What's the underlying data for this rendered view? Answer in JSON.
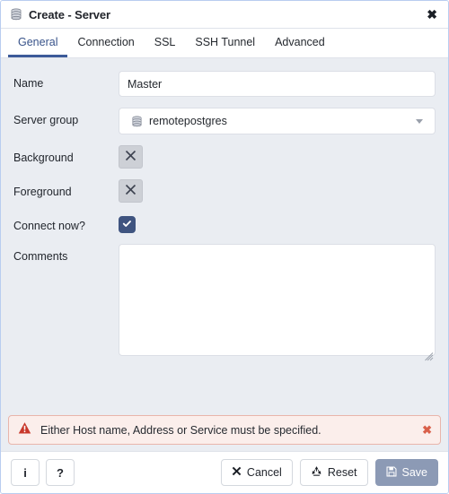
{
  "window": {
    "title": "Create - Server",
    "title_icon": "server-stack-icon",
    "close_label": "✖"
  },
  "tabs": [
    {
      "label": "General",
      "active": true
    },
    {
      "label": "Connection",
      "active": false
    },
    {
      "label": "SSL",
      "active": false
    },
    {
      "label": "SSH Tunnel",
      "active": false
    },
    {
      "label": "Advanced",
      "active": false
    }
  ],
  "form": {
    "name": {
      "label": "Name",
      "value": "Master",
      "placeholder": ""
    },
    "server_group": {
      "label": "Server group",
      "value": "remotepostgres",
      "icon": "server-stack-icon"
    },
    "background": {
      "label": "Background",
      "button_icon": "x-icon"
    },
    "foreground": {
      "label": "Foreground",
      "button_icon": "x-icon"
    },
    "connect_now": {
      "label": "Connect now?",
      "checked": true
    },
    "comments": {
      "label": "Comments",
      "value": "",
      "placeholder": ""
    }
  },
  "alert": {
    "icon": "warning-triangle-icon",
    "message": "Either Host name, Address or Service must be specified.",
    "close_label": "✖"
  },
  "footer": {
    "info_label": "i",
    "help_label": "?",
    "cancel_label": "Cancel",
    "reset_label": "Reset",
    "save_label": "Save"
  },
  "colors": {
    "accent": "#3c5a99",
    "tab_active_text": "#38538a",
    "body_bg": "#eaedf2",
    "checkbox_fill": "#3f5480",
    "alert_bg": "#fbeeeb",
    "alert_border": "#e8b5ab",
    "alert_icon": "#c8372a",
    "save_disabled_bg": "#8c9ab5",
    "window_border": "#b9cdf0"
  }
}
